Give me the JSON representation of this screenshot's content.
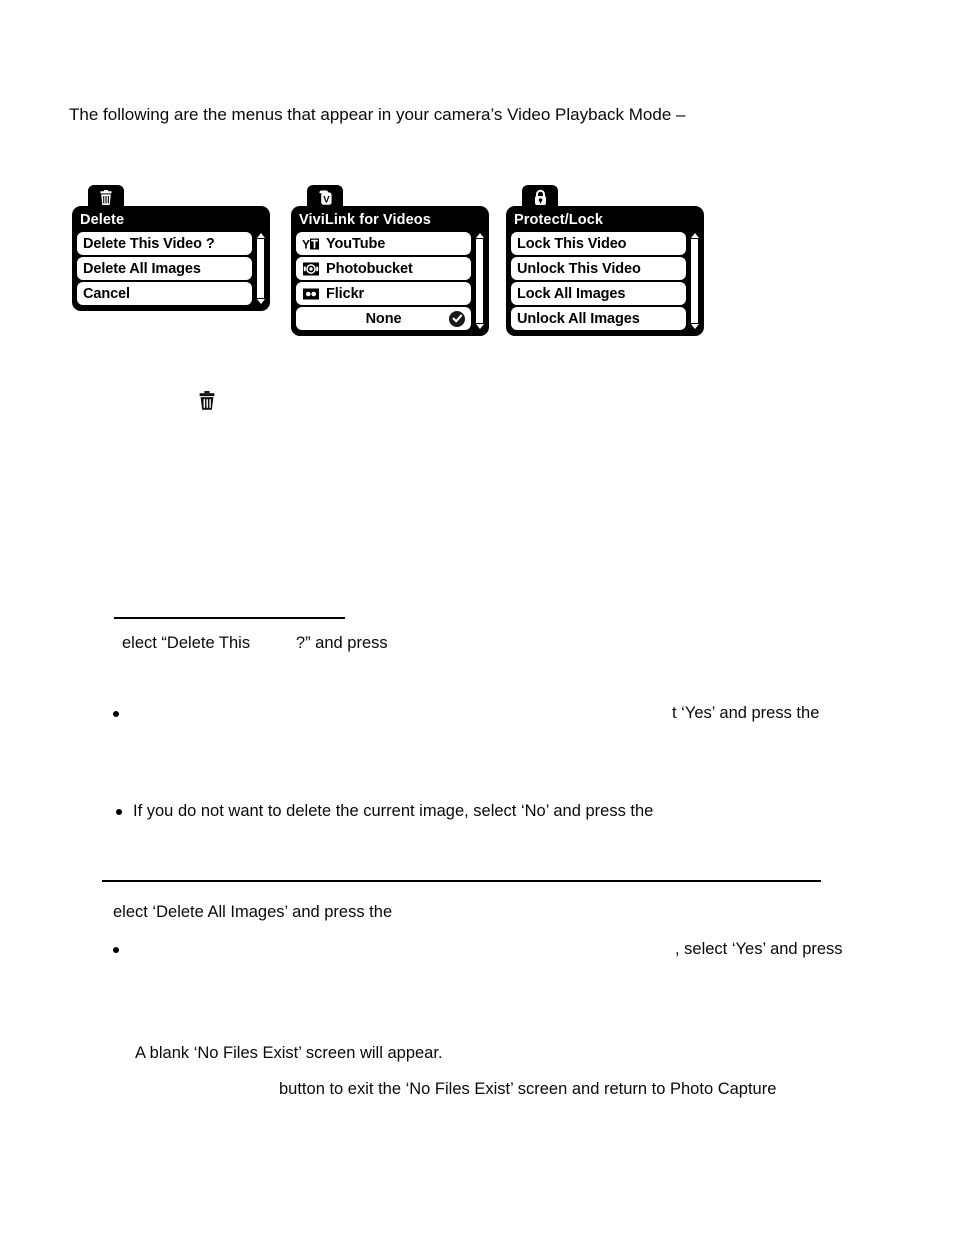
{
  "document": {
    "intro_line": "The following are the menus that appear in your camera’s Video Playback Mode –"
  },
  "menus": [
    {
      "id": "delete-menu",
      "tab_icon": "trash-icon",
      "title": "Delete",
      "items": [
        {
          "label": "Delete This Video ?",
          "icon": null,
          "selected": false
        },
        {
          "label": "Delete All Images",
          "icon": null,
          "selected": false
        },
        {
          "label": "Cancel",
          "icon": null,
          "selected": false
        }
      ],
      "has_scrollbar": true
    },
    {
      "id": "vivilink-menu",
      "tab_icon": "vivilink-icon",
      "title": "ViviLink for Videos",
      "items": [
        {
          "label": "YouTube",
          "icon": "youtube-icon",
          "selected": false
        },
        {
          "label": "Photobucket",
          "icon": "photobucket-icon",
          "selected": false
        },
        {
          "label": "Flickr",
          "icon": "flickr-icon",
          "selected": false
        },
        {
          "label": "None",
          "icon": null,
          "selected": true
        }
      ],
      "has_scrollbar": true
    },
    {
      "id": "protect-lock-menu",
      "tab_icon": "padlock-icon",
      "title": "Protect/Lock",
      "items": [
        {
          "label": "Lock This Video",
          "icon": null,
          "selected": false
        },
        {
          "label": "Unlock This Video",
          "icon": null,
          "selected": false
        },
        {
          "label": "Lock All Images",
          "icon": null,
          "selected": false
        },
        {
          "label": "Unlock All Images",
          "icon": null,
          "selected": false
        }
      ],
      "has_scrollbar": true
    }
  ],
  "body_text": {
    "line_delete_this": "elect “Delete This          ?” and press",
    "bullet_yes_fragment": "t ‘Yes’ and press the",
    "bullet_no_line": "If you do not want to delete the current image, select ‘No’ and press the",
    "line_delete_all": "elect ‘Delete All Images’ and press the",
    "bullet_select_yes_fragment": ", select ‘Yes’ and press",
    "line_no_files_exist": "A blank ‘No Files Exist’ screen will appear.",
    "line_exit_button": "button to exit the ‘No Files Exist’ screen and return to Photo Capture"
  },
  "colors": {
    "panel_background": "#000000",
    "row_background": "#ffffff",
    "text": "#000000",
    "page_background": "#ffffff"
  }
}
